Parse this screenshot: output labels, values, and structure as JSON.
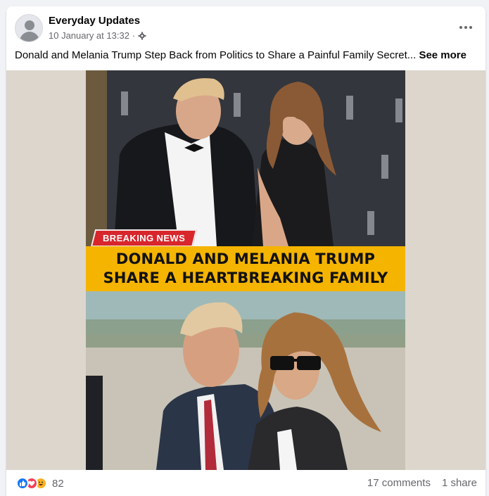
{
  "post": {
    "page_name": "Everyday Updates",
    "timestamp": "10 January at 13:32",
    "separator": "·",
    "audience_icon": "gear-icon",
    "more_icon": "ellipsis-icon",
    "text": "Donald and Melania Trump Step Back from Politics to Share a Painful Family Secret...",
    "see_more": "See more"
  },
  "image": {
    "breaking_label": "BREAKING NEWS",
    "headline_line1": "DONALD AND MELANIA TRUMP",
    "headline_line2": "SHARE A HEARTBREAKING FAMILY",
    "banner_color": "#f5b400",
    "breaking_color": "#d7262c"
  },
  "footer": {
    "reaction_icons": [
      "like-icon",
      "love-icon",
      "haha-icon"
    ],
    "reaction_count": "82",
    "comments": "17 comments",
    "shares": "1 share"
  }
}
